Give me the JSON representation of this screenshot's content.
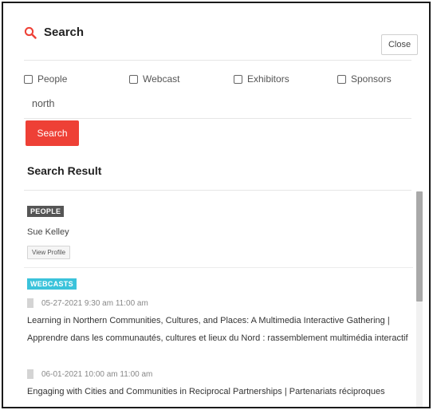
{
  "header": {
    "title": "Search",
    "icon": "search-icon",
    "close_label": "Close",
    "accent": "#ee4036"
  },
  "filters": [
    {
      "label": "People",
      "checked": false
    },
    {
      "label": "Webcast",
      "checked": false
    },
    {
      "label": "Exhibitors",
      "checked": false
    },
    {
      "label": "Sponsors",
      "checked": false
    }
  ],
  "search": {
    "value": "north",
    "button_label": "Search"
  },
  "results": {
    "heading": "Search Result",
    "people": {
      "badge": "PEOPLE",
      "items": [
        {
          "name": "Sue Kelley",
          "action": "View Profile"
        }
      ]
    },
    "webcasts": {
      "badge": "WEBCASTS",
      "badge_color": "#3bc3db",
      "items": [
        {
          "date": "05-27-2021 9:30 am 11:00 am",
          "title": "Learning in Northern Communities, Cultures, and Places: A Multimedia Interactive Gathering | Apprendre dans les communautés, cultures et lieux du Nord : rassemblement multimédia interactif"
        },
        {
          "date": "06-01-2021 10:00 am 11:00 am",
          "title": "Engaging with Cities and Communities in Reciprocal Partnerships | Partenariats réciproques"
        }
      ]
    }
  }
}
